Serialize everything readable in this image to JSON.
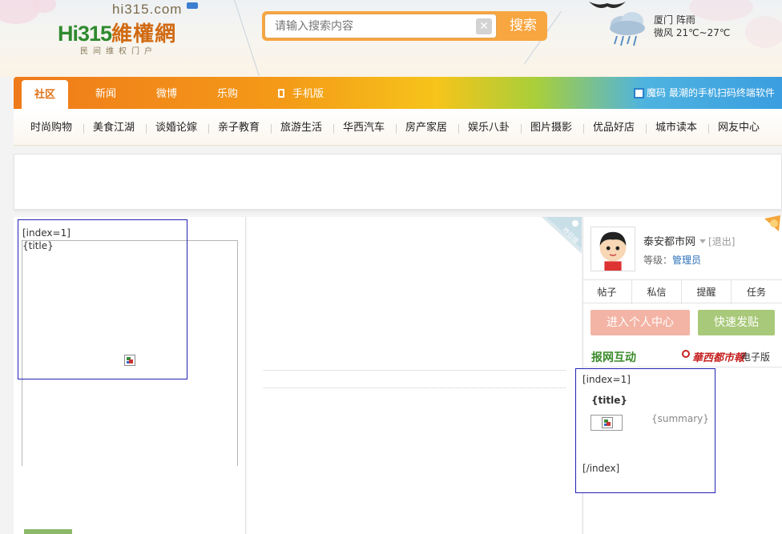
{
  "header": {
    "site_domain": "hi315.com",
    "logo_text": "Hi315",
    "logo_cn": "維權網",
    "logo_slogan": "民间维权门户",
    "search_placeholder": "请输入搜索内容",
    "search_clear": "✕",
    "search_button": "搜索",
    "weather_city": "厦门 阵雨",
    "weather_detail": "微风 21℃~27℃"
  },
  "nav": {
    "items": [
      "社区",
      "新闻",
      "微博",
      "乐购",
      "手机版"
    ],
    "active_index": 0,
    "qr_text": "魔码 最潮的手机扫码终端软件"
  },
  "subnav": {
    "items": [
      "时尚购物",
      "美食江湖",
      "谈婚论嫁",
      "亲子教育",
      "旅游生活",
      "华西汽车",
      "房产家居",
      "娱乐八卦",
      "图片摄影",
      "优品好店",
      "城市读本",
      "网友中心"
    ]
  },
  "left_block": {
    "index_tag": "[index=1]",
    "title_tag": "{title}"
  },
  "stamp_text": "昨日版",
  "user": {
    "name": "泰安都市网",
    "logout": "[退出]",
    "level_label": "等级：",
    "level_value": "管理员",
    "tabs": [
      "帖子",
      "私信",
      "提醒",
      "任务"
    ],
    "btn_center": "进入个人中心",
    "btn_post": "快速发贴"
  },
  "interact": {
    "title": "报网互动",
    "paper_name": "華西都市報",
    "paper_edition": "电子版"
  },
  "right_block": {
    "index_open": "[index=1]",
    "title_tag": "{title}",
    "summary_tag": "{summary}",
    "index_close": "[/index]"
  },
  "colors": {
    "accent_orange": "#f49a18",
    "brand_green": "#2f8a2f",
    "template_border": "#2323b5"
  }
}
